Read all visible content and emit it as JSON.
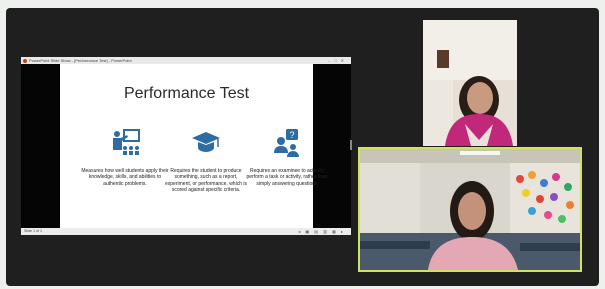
{
  "window": {
    "app_title": "PowerPoint Slide Show - [Performance Test] - PowerPoint"
  },
  "slide": {
    "title": "Performance Test",
    "columns": [
      {
        "icon": "teacher-presenting-icon",
        "text": "Measures how well students apply their knowledge, skills, and abilities to authentic problems."
      },
      {
        "icon": "graduation-cap-icon",
        "text": "Requires the student to produce something, such as a report, experiment, or performance, which is scored against specific criteria."
      },
      {
        "icon": "person-question-icon",
        "text": "Requires an examinee to actually perform a task or activity, rather than simply answering questions"
      }
    ],
    "accent_color": "#2e6da4",
    "slide_number": "Slide 1 of 1"
  },
  "participants": [
    {
      "role": "presenter-camera",
      "active_speaker": false
    },
    {
      "role": "speaker-camera",
      "active_speaker": true,
      "highlight_color": "#cfe35d"
    }
  ]
}
